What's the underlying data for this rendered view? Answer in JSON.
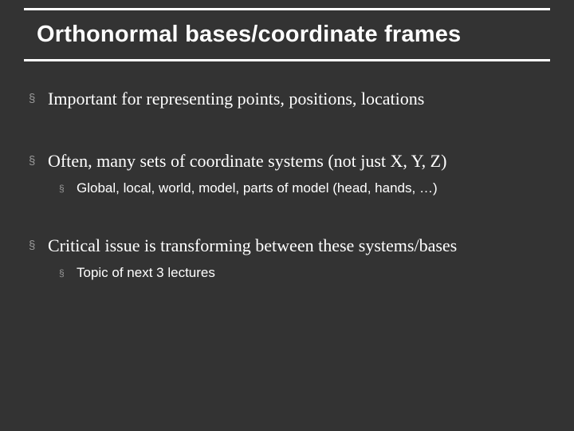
{
  "slide": {
    "title": "Orthonormal bases/coordinate frames",
    "bullets": [
      {
        "text": "Important for representing points, positions, locations",
        "children": []
      },
      {
        "text": "Often, many sets of coordinate systems (not just X, Y, Z)",
        "children": [
          {
            "text": "Global, local, world, model, parts of model (head, hands, …)"
          }
        ]
      },
      {
        "text": "Critical issue is transforming between these systems/bases",
        "children": [
          {
            "text": "Topic of next 3 lectures"
          }
        ]
      }
    ]
  }
}
